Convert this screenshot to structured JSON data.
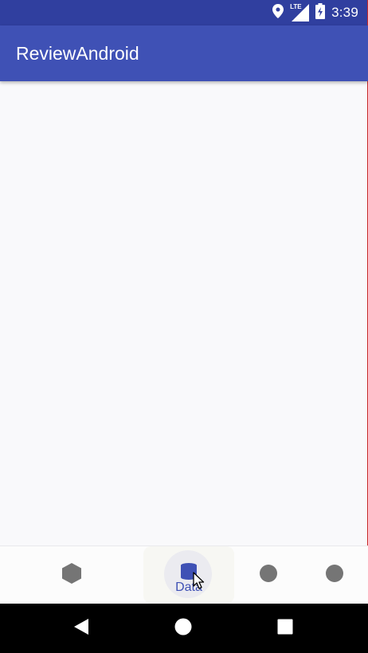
{
  "status_bar": {
    "time": "3:39",
    "network_label": "LTE",
    "icons": [
      "location-icon",
      "signal-icon",
      "battery-charging-icon"
    ]
  },
  "app_bar": {
    "title": "ReviewAndroid"
  },
  "bottom_nav": {
    "items": [
      {
        "icon": "hexagon-icon",
        "label": "",
        "selected": false
      },
      {
        "icon": "database-icon",
        "label": "Data",
        "selected": true
      },
      {
        "icon": "circle-icon",
        "label": "",
        "selected": false
      },
      {
        "icon": "circle-icon",
        "label": "",
        "selected": false
      }
    ]
  },
  "system_nav": {
    "buttons": [
      "back-icon",
      "home-icon",
      "recents-icon"
    ]
  },
  "colors": {
    "status_bar": "#303f9f",
    "app_bar": "#3f51b5",
    "accent": "#3f51b5",
    "inactive_icon": "#757575",
    "content_background": "#f9f9fb",
    "system_nav": "#000000"
  }
}
